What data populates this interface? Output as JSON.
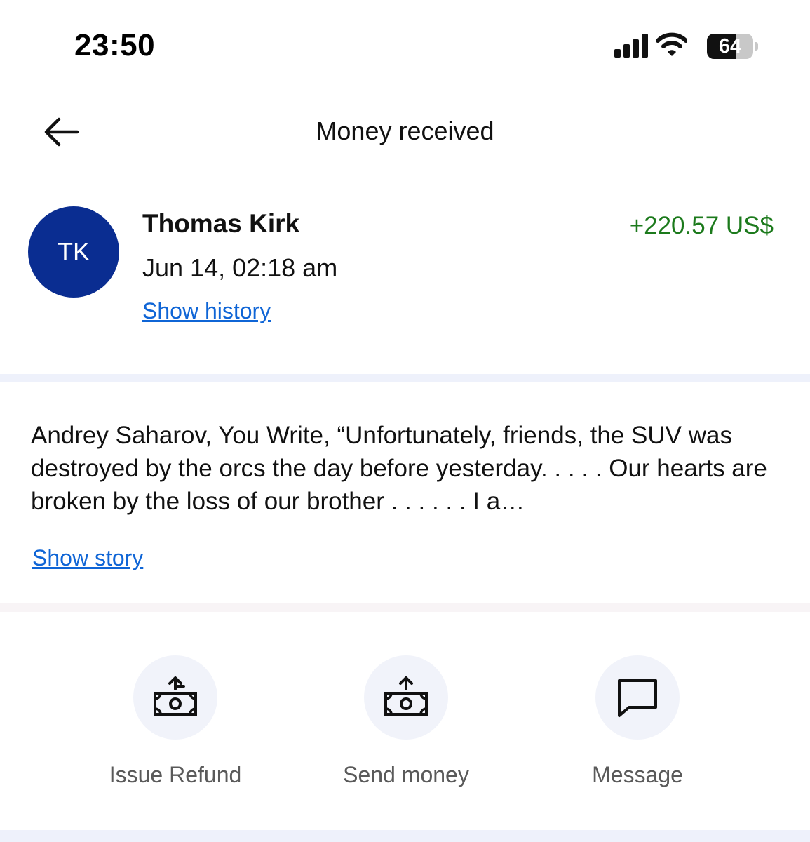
{
  "status_bar": {
    "time": "23:50",
    "battery_level": "64",
    "icons": [
      "cellular-signal-icon",
      "wifi-icon",
      "battery-icon"
    ]
  },
  "nav": {
    "back_icon": "arrow-left-icon",
    "title": "Money received"
  },
  "transaction": {
    "avatar_initials": "TK",
    "sender_name": "Thomas Kirk",
    "date": "Jun 14, 02:18 am",
    "amount": "+220.57 US$",
    "show_history_label": "Show history"
  },
  "note": {
    "text": "Andrey Saharov, You Write, “Unfortunately, friends, the SUV was destroyed by the orcs the day before yesterday. . . . . Our hearts are broken by the loss of our brother . . . . . .  I a…",
    "show_story_label": "Show story"
  },
  "actions": [
    {
      "label": "Issue Refund",
      "icon": "cash-upload-icon"
    },
    {
      "label": "Send money",
      "icon": "cash-send-icon"
    },
    {
      "label": "Message",
      "icon": "chat-bubble-icon"
    }
  ],
  "colors": {
    "avatar_bg": "#0a2d91",
    "amount_positive": "#1c7a1c",
    "link": "#0f65d6",
    "divider": "#eef1fb"
  }
}
